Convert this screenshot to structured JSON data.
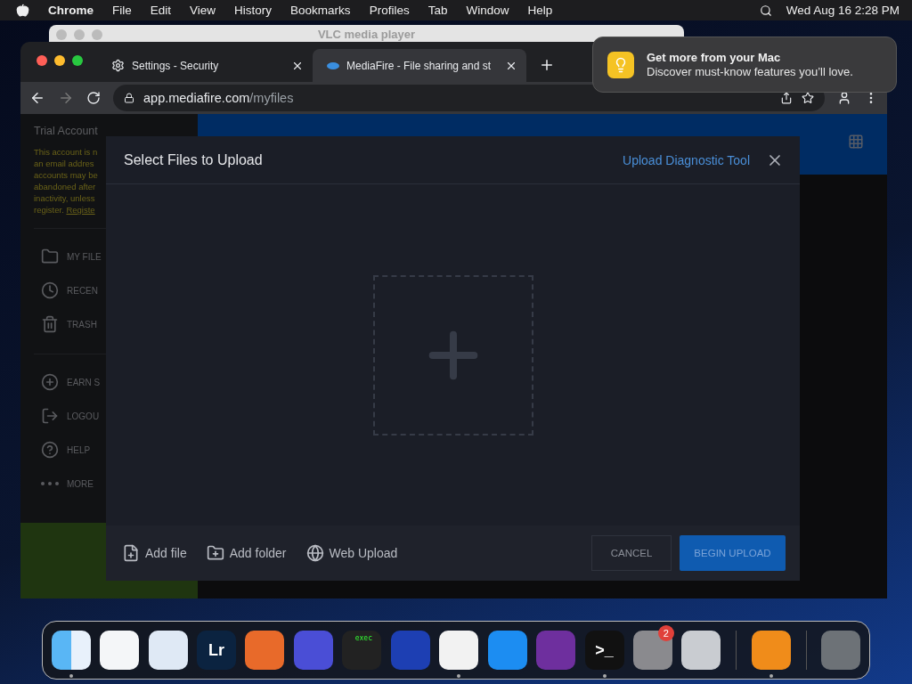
{
  "menu_bar": {
    "app": "Chrome",
    "items": [
      "File",
      "Edit",
      "View",
      "History",
      "Bookmarks",
      "Profiles",
      "Tab",
      "Window",
      "Help"
    ],
    "clock": "Wed Aug 16  2:28 PM"
  },
  "background_window": {
    "title": "VLC media player"
  },
  "notification": {
    "title": "Get more from your Mac",
    "body": "Discover must-know features you’ll love."
  },
  "browser": {
    "tabs": [
      {
        "kind": "settings",
        "label": "Settings - Security",
        "selected": false
      },
      {
        "kind": "site",
        "label": "MediaFire - File sharing and st",
        "selected": true
      }
    ],
    "url": {
      "host": "app.mediafire.com",
      "path": "/myfiles"
    }
  },
  "sidebar": {
    "title": "Trial Account",
    "notice": [
      "This account is n",
      "an email addres",
      "accounts may be",
      "abandoned after",
      "inactivity, unless"
    ],
    "notice_end": "register.",
    "register_link": "Registe",
    "items": [
      {
        "kind": "folder",
        "label": "MY FILE"
      },
      {
        "kind": "clock",
        "label": "RECEN"
      },
      {
        "kind": "trash",
        "label": "TRASH"
      },
      {
        "kind": "plus",
        "label": "EARN S",
        "group_start": true
      },
      {
        "kind": "logout",
        "label": "LOGOU"
      },
      {
        "kind": "help",
        "label": "HELP"
      },
      {
        "kind": "more",
        "label": "MORE"
      }
    ]
  },
  "dialog": {
    "title": "Select Files to Upload",
    "diagnostic_link": "Upload Diagnostic Tool",
    "sources": [
      {
        "kind": "file",
        "label": "Add file"
      },
      {
        "kind": "folder",
        "label": "Add folder"
      },
      {
        "kind": "web",
        "label": "Web Upload"
      }
    ],
    "cancel": "CANCEL",
    "begin": "BEGIN UPLOAD"
  },
  "dock": [
    {
      "kind": "finder",
      "running": true
    },
    {
      "kind": "vscode",
      "running": false
    },
    {
      "kind": "safari",
      "running": false
    },
    {
      "kind": "lightroom",
      "label": "Lr",
      "running": false
    },
    {
      "kind": "firefox",
      "running": false
    },
    {
      "kind": "firefox-dev",
      "running": false
    },
    {
      "kind": "console",
      "label": "exec",
      "running": false
    },
    {
      "kind": "squares",
      "running": false
    },
    {
      "kind": "chrome",
      "running": true
    },
    {
      "kind": "appstore",
      "running": false
    },
    {
      "kind": "github",
      "running": false
    },
    {
      "kind": "terminal",
      "label": ">_",
      "running": true
    },
    {
      "kind": "settings",
      "badge": "2",
      "running": false
    },
    {
      "kind": "launchpad",
      "running": false
    },
    {
      "kind": "separator"
    },
    {
      "kind": "vlc",
      "running": true
    },
    {
      "kind": "separator"
    },
    {
      "kind": "trash",
      "running": false
    }
  ]
}
